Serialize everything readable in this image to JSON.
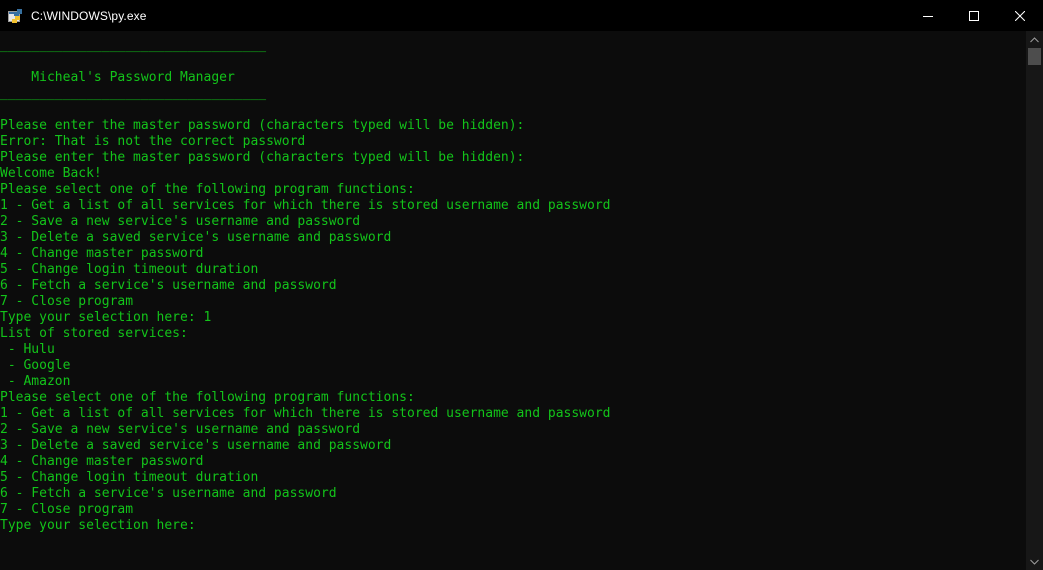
{
  "window": {
    "title": "C:\\WINDOWS\\py.exe",
    "icon": "python-console-icon",
    "controls": [
      "minimize-icon",
      "maximize-icon",
      "close-icon"
    ]
  },
  "colors": {
    "console_background": "#0c0c0c",
    "text": "#13c41a",
    "titlebar": "#000000"
  },
  "console": {
    "lines": [
      "__________________________________",
      "",
      "    Micheal's Password Manager",
      "__________________________________",
      "",
      "Please enter the master password (characters typed will be hidden):",
      "Error: That is not the correct password",
      "Please enter the master password (characters typed will be hidden):",
      "Welcome Back!",
      "Please select one of the following program functions:",
      "1 - Get a list of all services for which there is stored username and password",
      "2 - Save a new service's username and password",
      "3 - Delete a saved service's username and password",
      "4 - Change master password",
      "5 - Change login timeout duration",
      "6 - Fetch a service's username and password",
      "7 - Close program",
      "Type your selection here: 1",
      "List of stored services:",
      " - Hulu",
      " - Google",
      " - Amazon",
      "Please select one of the following program functions:",
      "1 - Get a list of all services for which there is stored username and password",
      "2 - Save a new service's username and password",
      "3 - Delete a saved service's username and password",
      "4 - Change master password",
      "5 - Change login timeout duration",
      "6 - Fetch a service's username and password",
      "7 - Close program",
      "Type your selection here:"
    ]
  }
}
